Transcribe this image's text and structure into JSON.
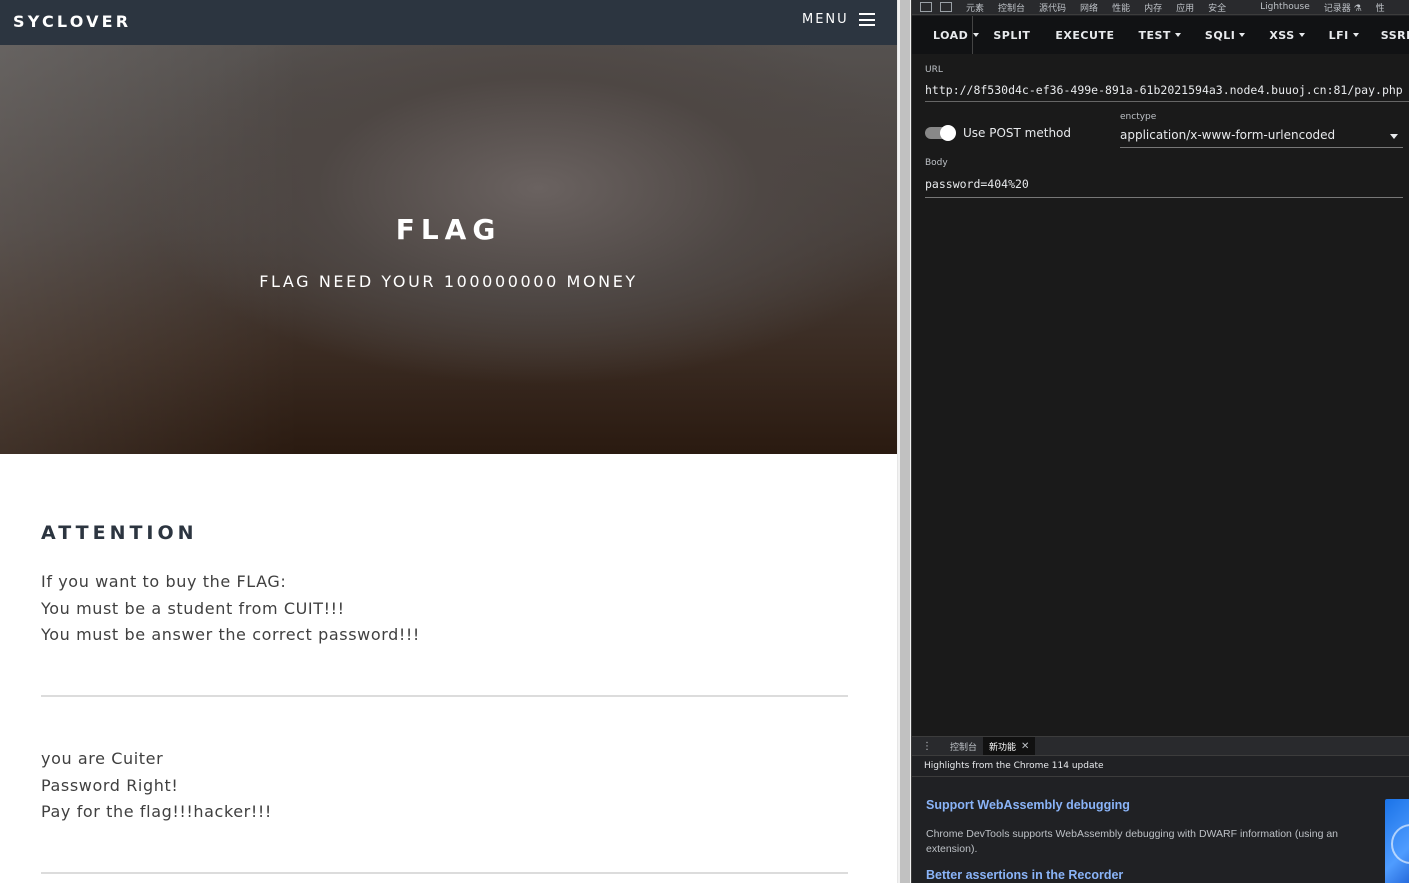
{
  "site": {
    "brand": "SYCLOVER",
    "menu_label": "MENU",
    "hero_title": "FLAG",
    "hero_subtitle": "FLAG NEED YOUR 100000000 MONEY",
    "attention_heading": "ATTENTION",
    "attention_lines": [
      "If you want to buy the FLAG:",
      "You must be a student from CUIT!!!",
      "You must be answer the correct password!!!"
    ],
    "result_lines": [
      "you are Cuiter",
      "Password Right!",
      "Pay for the flag!!!hacker!!!"
    ]
  },
  "devtools": {
    "panel_tabs": [
      "元素",
      "控制台",
      "源代码",
      "网络",
      "性能",
      "内存",
      "应用",
      "安全",
      "Lighthouse",
      "记录器 ⚗",
      "性"
    ],
    "hackbar_buttons": [
      "LOAD",
      "SPLIT",
      "EXECUTE",
      "TEST",
      "SQLI",
      "XSS",
      "LFI",
      "SSRF"
    ],
    "url_label": "URL",
    "url_value": "http://8f530d4c-ef36-499e-891a-61b2021594a3.node4.buuoj.cn:81/pay.php",
    "post_toggle_label": "Use POST method",
    "post_enabled": true,
    "enctype_label": "enctype",
    "enctype_value": "application/x-www-form-urlencoded",
    "body_label": "Body",
    "body_value": "password=404%20",
    "drawer_tabs": [
      "控制台",
      "新功能"
    ],
    "whats_new_header": "Highlights from the Chrome 114 update",
    "whats_new_title_1": "Support WebAssembly debugging",
    "whats_new_desc_1": "Chrome DevTools supports WebAssembly debugging with DWARF information (using an extension).",
    "whats_new_title_2": "Better assertions in the Recorder"
  },
  "colors": {
    "navbar": "#2c3540",
    "devtools_bg": "#202124",
    "link_blue": "#8ab4f8"
  }
}
